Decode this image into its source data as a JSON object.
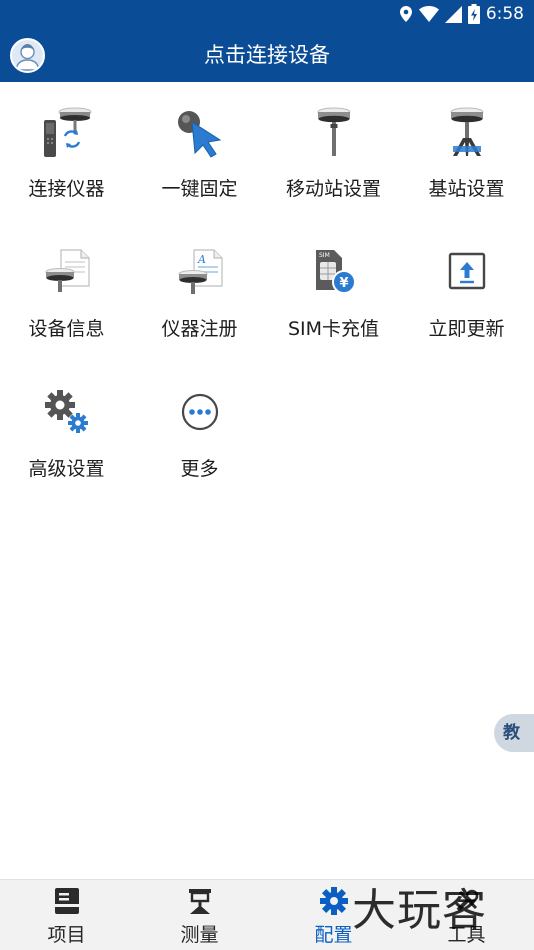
{
  "status_bar": {
    "time": "6:58"
  },
  "app_bar": {
    "title": "点击连接设备"
  },
  "grid": {
    "items": [
      {
        "label": "连接仪器",
        "icon": "connect-instrument-icon"
      },
      {
        "label": "一键固定",
        "icon": "one-click-fix-icon"
      },
      {
        "label": "移动站设置",
        "icon": "rover-station-icon"
      },
      {
        "label": "基站设置",
        "icon": "base-station-icon"
      },
      {
        "label": "设备信息",
        "icon": "device-info-icon"
      },
      {
        "label": "仪器注册",
        "icon": "instrument-register-icon"
      },
      {
        "label": "SIM卡充值",
        "icon": "sim-recharge-icon"
      },
      {
        "label": "立即更新",
        "icon": "update-icon"
      },
      {
        "label": "高级设置",
        "icon": "advanced-settings-icon"
      },
      {
        "label": "更多",
        "icon": "more-icon"
      }
    ]
  },
  "side_tab": {
    "label": "教"
  },
  "bottom_nav": {
    "items": [
      {
        "label": "项目",
        "icon": "project-icon",
        "active": false
      },
      {
        "label": "测量",
        "icon": "survey-icon",
        "active": false
      },
      {
        "label": "配置",
        "icon": "config-icon",
        "active": true
      },
      {
        "label": "工具",
        "icon": "tools-icon",
        "active": false
      }
    ]
  },
  "watermark": {
    "text": "大玩客"
  },
  "colors": {
    "primary": "#0b4c97",
    "accent": "#0b5ec2",
    "nav_bg": "#f2f2f2"
  }
}
